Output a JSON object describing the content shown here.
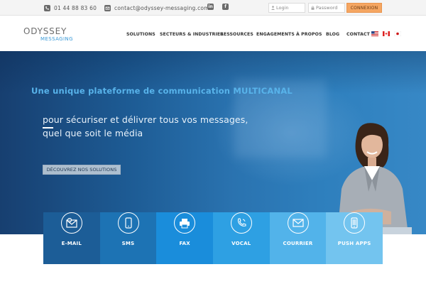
{
  "topbar": {
    "phone": "01 44 88 83 60",
    "email": "contact@odyssey-messaging.com",
    "social": [
      {
        "icon": "linkedin-icon",
        "glyph": "in"
      },
      {
        "icon": "facebook-icon",
        "glyph": "f"
      }
    ],
    "login_placeholder": "Login",
    "password_placeholder": "Password",
    "connexion_label": "CONNEXION"
  },
  "logo": {
    "top": "ODYSSEY",
    "bottom": "MESSAGING"
  },
  "nav": [
    {
      "label": "SOLUTIONS"
    },
    {
      "label": "SECTEURS & INDUSTRIES"
    },
    {
      "label": "RESSOURCES"
    },
    {
      "label": "ENGAGEMENTS"
    },
    {
      "label": "À PROPOS"
    },
    {
      "label": "BLOG"
    },
    {
      "label": "CONTACT"
    }
  ],
  "flags": [
    "us-flag-icon",
    "canada-flag-icon",
    "japan-flag-icon"
  ],
  "hero": {
    "title": "Une unique plateforme de communication MULTICANAL",
    "subtitle_line1": "pour sécuriser et délivrer tous vos messages,",
    "subtitle_line2": "quel que soit le média",
    "cta_label": "DÉCOUVREZ NOS SOLUTIONS"
  },
  "channels": [
    {
      "label": "E-MAIL",
      "icon": "email-icon",
      "color": "#1c5d97"
    },
    {
      "label": "SMS",
      "icon": "mobile-icon",
      "color": "#1d73b4"
    },
    {
      "label": "FAX",
      "icon": "fax-icon",
      "color": "#1a8ddb"
    },
    {
      "label": "VOCAL",
      "icon": "phone-icon",
      "color": "#2ea0e3"
    },
    {
      "label": "COURRIER",
      "icon": "envelope-icon",
      "color": "#52b3ea"
    },
    {
      "label": "PUSH APPS",
      "icon": "smartphone-icon",
      "color": "#73c4ef"
    }
  ],
  "colors": {
    "accent_orange": "#f5a662",
    "brand_blue": "#3a9ad8",
    "hero_title": "#58b3ea"
  }
}
